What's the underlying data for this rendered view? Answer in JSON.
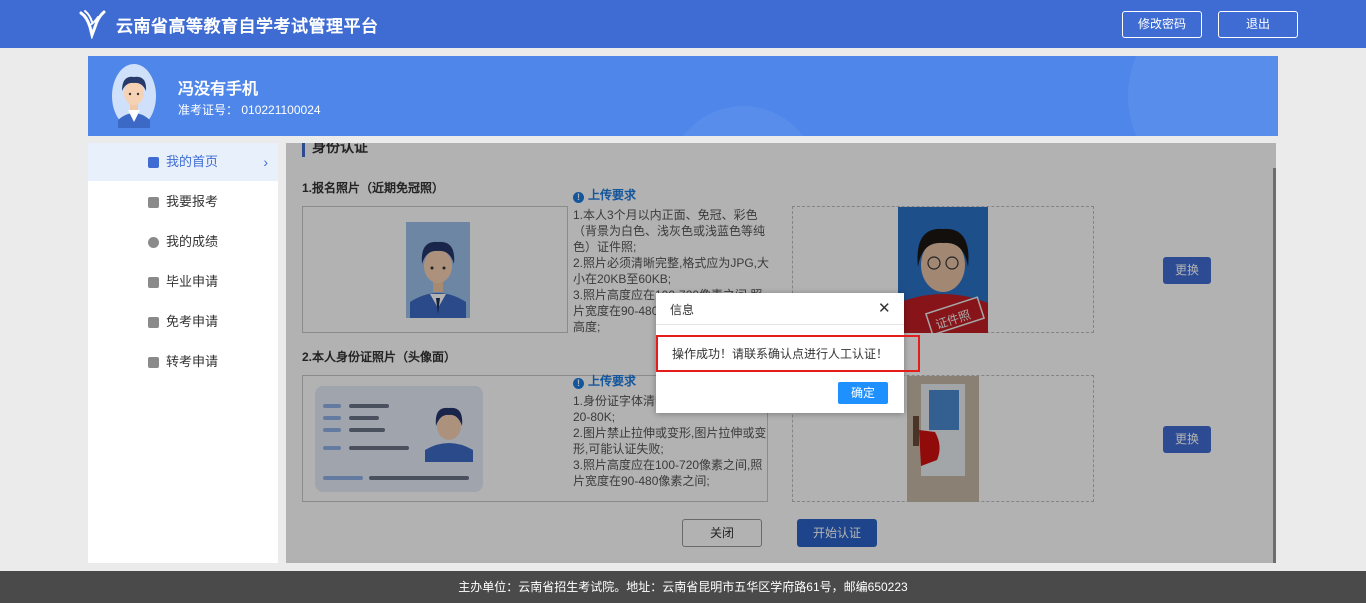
{
  "header": {
    "site_title": "云南省高等教育自学考试管理平台",
    "change_password": "修改密码",
    "logout": "退出",
    "logo_icon": "platform-logo-icon"
  },
  "profile": {
    "name": "冯没有手机",
    "exam_id_label": "准考证号：",
    "exam_id": "010221100024"
  },
  "sidebar": {
    "items": [
      {
        "label": "我的首页",
        "icon": "home-icon",
        "active": true
      },
      {
        "label": "我要报考",
        "icon": "register-icon",
        "active": false
      },
      {
        "label": "我的成绩",
        "icon": "score-icon",
        "active": false
      },
      {
        "label": "毕业申请",
        "icon": "graduation-icon",
        "active": false
      },
      {
        "label": "免考申请",
        "icon": "exemption-icon",
        "active": false
      },
      {
        "label": "转考申请",
        "icon": "transfer-icon",
        "active": false
      }
    ],
    "active_chevron": "›"
  },
  "main": {
    "section_title": "身份认证",
    "photo": {
      "label": "1.报名照片（近期免冠照）",
      "req_title": "上传要求",
      "req_text": "1.本人3个月以内正面、免冠、彩色（背景为白色、浅灰色或浅蓝色等纯色）证件照;\n2.照片必须清晰完整,格式应为JPG,大小在20KB至60KB;\n3.照片高度应在100-720像素之间,照片宽度在90-480像素之间;\n高度;",
      "stamp_text": "证件照",
      "replace": "更换"
    },
    "idcard": {
      "label": "2.本人身份证照片（头像面）",
      "req_title": "上传要求",
      "req_text": "1.身份证字体清晰,格式为JPG,大小为20-80K;\n2.图片禁止拉伸或变形,图片拉伸或变形,可能认证失败;\n3.照片高度应在100-720像素之间,照片宽度在90-480像素之间;",
      "replace": "更换"
    },
    "close": "关闭",
    "start": "开始认证"
  },
  "dialog": {
    "title": "信息",
    "close_symbol": "✕",
    "message": "操作成功！请联系确认点进行人工认证！",
    "ok": "确定"
  },
  "footer": {
    "text": "主办单位：云南省招生考试院。地址：云南省昆明市五华区学府路61号，邮编650223"
  },
  "colors": {
    "brand": "#3f6cd3",
    "banner": "#4e86ea",
    "highlight": "#e51c1c",
    "ok_button": "#1e90ff"
  }
}
